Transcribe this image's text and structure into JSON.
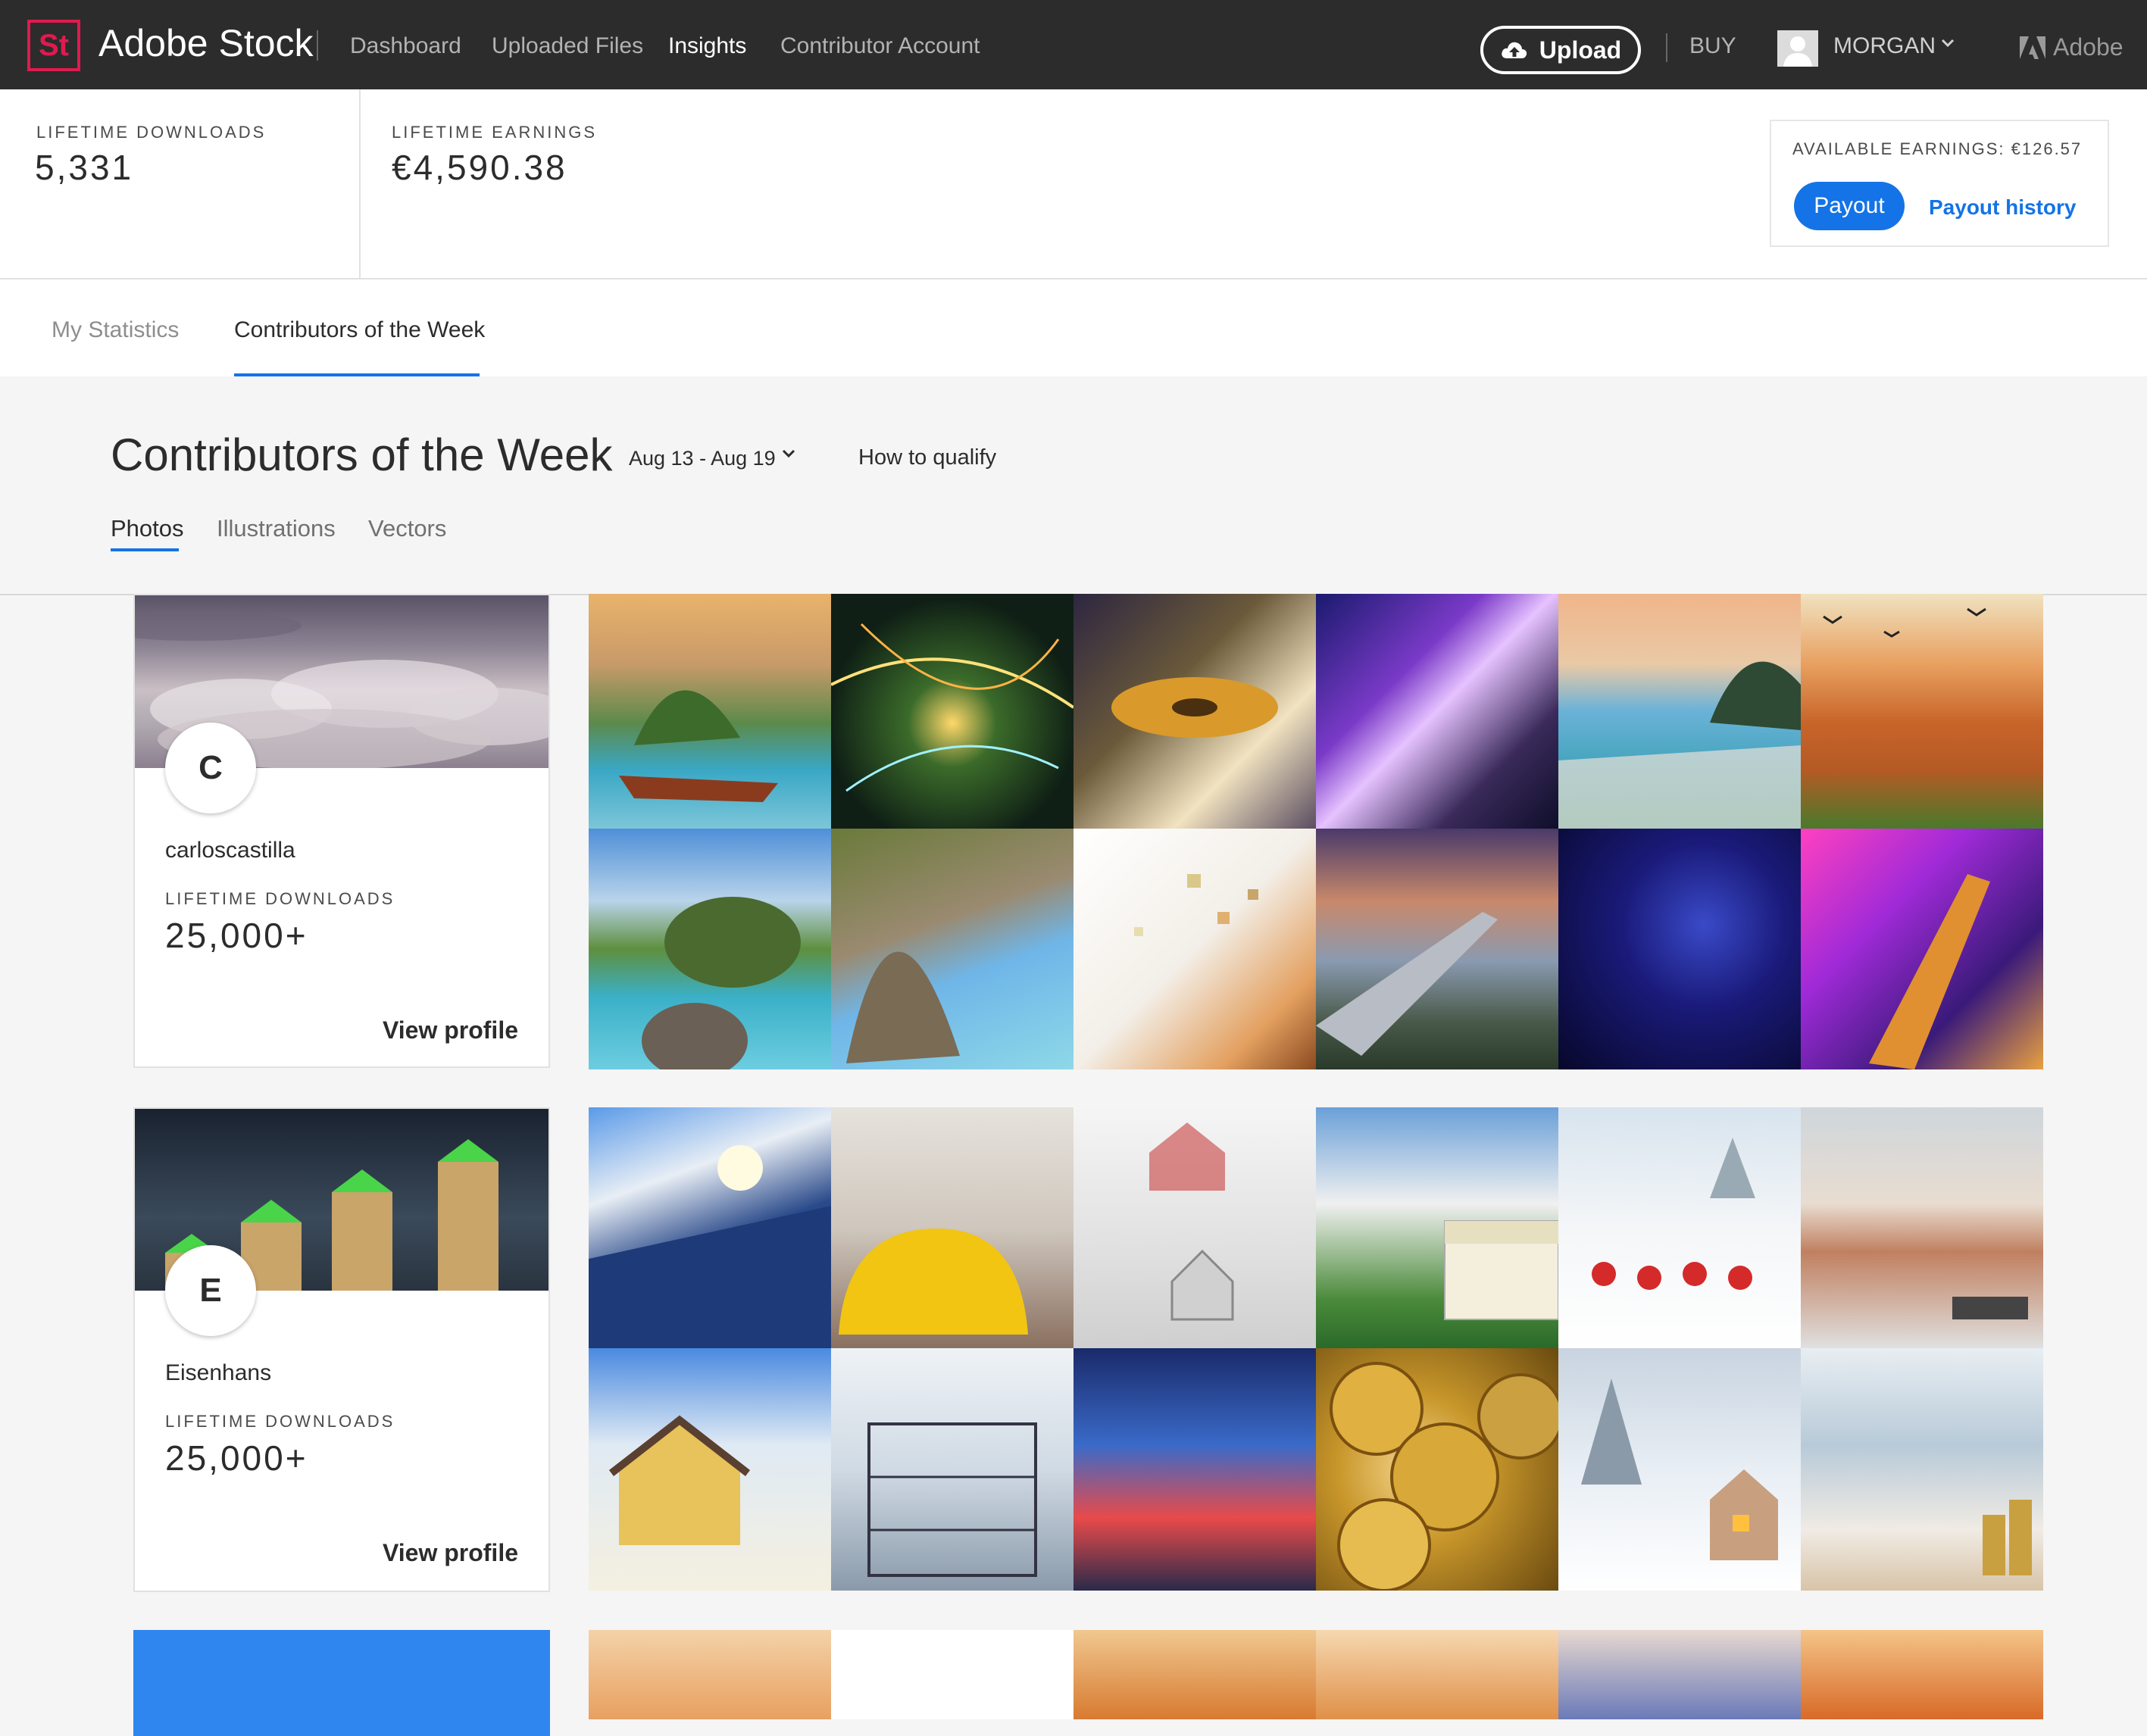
{
  "header": {
    "logo": "St",
    "brand": "Adobe Stock",
    "nav": [
      "Dashboard",
      "Uploaded Files",
      "Insights",
      "Contributor Account"
    ],
    "active_nav": "Insights",
    "upload_label": "Upload",
    "buy_label": "BUY",
    "user_name": "MORGAN",
    "adobe_label": "Adobe"
  },
  "stats": {
    "downloads_label": "LIFETIME DOWNLOADS",
    "downloads_value": "5,331",
    "earnings_label": "LIFETIME EARNINGS",
    "earnings_value": "€4,590.38",
    "available_label": "AVAILABLE EARNINGS:",
    "available_value": "€126.57",
    "payout_label": "Payout",
    "payout_history_label": "Payout history"
  },
  "tabs": [
    "My Statistics",
    "Contributors of the Week"
  ],
  "page": {
    "title": "Contributors of the Week",
    "date_range": "Aug 13 - Aug 19",
    "how_to_qualify": "How to qualify",
    "subtabs": [
      "Photos",
      "Illustrations",
      "Vectors"
    ]
  },
  "contributors": [
    {
      "initial": "C",
      "name": "carloscastilla",
      "downloads_label": "LIFETIME DOWNLOADS",
      "downloads_value": "25,000+",
      "view_label": "View profile",
      "cover_color": "#8a8090"
    },
    {
      "initial": "E",
      "name": "Eisenhans",
      "downloads_label": "LIFETIME DOWNLOADS",
      "downloads_value": "25,000+",
      "view_label": "View profile",
      "cover_color": "#2a3440"
    }
  ],
  "colors": {
    "accent": "#1473e6",
    "brand_red": "#e01a4f",
    "topbar": "#2c2c2c",
    "third_card_cover": "#2f86ee"
  }
}
